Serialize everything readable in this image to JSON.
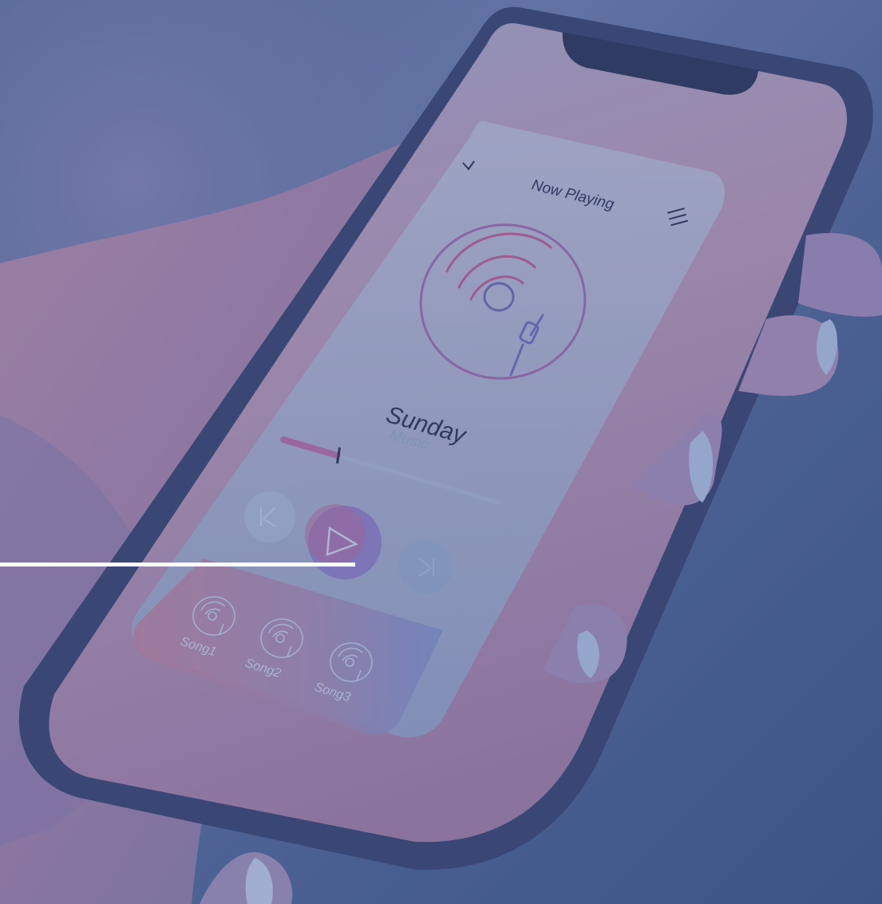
{
  "image": {
    "accent_color": "#ffffff",
    "overlay_color": "#3e5a8e"
  },
  "player": {
    "header_title": "Now Playing",
    "back_icon": "chevron-down-icon",
    "menu_icon": "hamburger-menu-icon",
    "album_art_icon": "vinyl-record-icon",
    "track_title": "Sunday",
    "track_artist": "Music",
    "progress": 0.25,
    "controls": {
      "prev_icon": "previous-icon",
      "play_icon": "play-icon",
      "next_icon": "next-icon"
    },
    "playlist": [
      {
        "label": "Song1",
        "icon": "vinyl-record-icon"
      },
      {
        "label": "Song2",
        "icon": "vinyl-record-icon"
      },
      {
        "label": "Song3",
        "icon": "vinyl-record-icon"
      }
    ]
  }
}
